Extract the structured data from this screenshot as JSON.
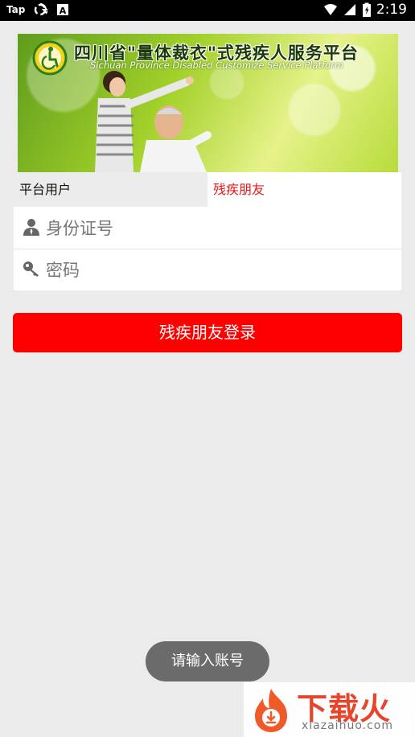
{
  "status_bar": {
    "carrier": "Tap",
    "time": "2:19",
    "icons": [
      "sync-icon",
      "text-a-icon",
      "wifi-icon",
      "signal-icon",
      "battery-icon"
    ]
  },
  "banner": {
    "title_cn": "四川省\"量体裁衣\"式残疾人服务平台",
    "title_en": "Sichuan Province Disabled Customize Service Platform",
    "logo_icon": "disability-logo-icon"
  },
  "tabs": [
    {
      "label": "平台用户",
      "selected": false
    },
    {
      "label": "残疾朋友",
      "selected": true
    }
  ],
  "form": {
    "id_placeholder": "身份证号",
    "id_value": "",
    "password_placeholder": "密码",
    "password_value": ""
  },
  "login_button": {
    "label": "残疾朋友登录"
  },
  "toast": {
    "text": "请输入账号"
  },
  "watermark": {
    "text_cn": "下载火",
    "text_en": "xiazaihuo.com"
  },
  "colors": {
    "accent": "#ff0000",
    "tab_selected_text": "#e51919",
    "background": "#ebebeb"
  }
}
